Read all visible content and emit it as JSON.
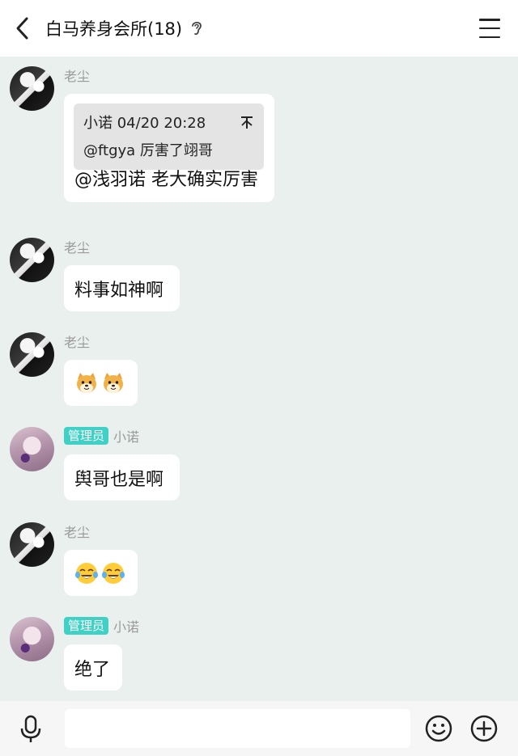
{
  "header": {
    "title": "白马养身会所(18)",
    "back_icon": "chevron-left-icon",
    "mute_icon": "ear-icon",
    "menu_icon": "hamburger-menu-icon"
  },
  "messages": [
    {
      "sender": "老尘",
      "quote": {
        "author_time": "小诺 04/20 20:28",
        "text": "@ftgya 厉害了翊哥"
      },
      "text": "@浅羽诺 老大确实厉害"
    },
    {
      "sender": "老尘",
      "text": "料事如神啊"
    },
    {
      "sender": "老尘",
      "emojis": [
        "dog-face-emoji",
        "dog-face-emoji"
      ]
    },
    {
      "sender": "小诺",
      "role_badge": "管理员",
      "text": "舆哥也是啊"
    },
    {
      "sender": "老尘",
      "emojis": [
        "tears-of-joy-emoji",
        "tears-of-joy-emoji"
      ]
    },
    {
      "sender": "小诺",
      "role_badge": "管理员",
      "text": "绝了"
    }
  ],
  "input_bar": {
    "placeholder": "",
    "mic_icon": "microphone-icon",
    "emoji_icon": "smiley-icon",
    "plus_icon": "plus-circle-icon"
  },
  "colors": {
    "chat_background": "#eaf0ed",
    "admin_badge": "#3fd0c6",
    "bubble": "#ffffff",
    "quote_background": "#e4e4e4"
  }
}
